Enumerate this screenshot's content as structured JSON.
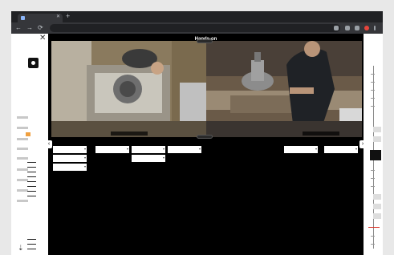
{
  "browser": {
    "tab_title": "",
    "new_tab": "+",
    "back": "←",
    "forward": "→",
    "reload": "⟳",
    "url": ""
  },
  "left_panel": {
    "pager": "",
    "close": "✕",
    "accent_color": "#f0a040",
    "footer_arrow": "⇣"
  },
  "right_panel": {
    "time": "",
    "date_day": "",
    "date_month": "",
    "marker_color": "#d93025",
    "badge": ""
  },
  "main": {
    "info_label": "",
    "title": "Hands-on",
    "zoom_out": "",
    "zoom_in": "",
    "prev": "‹",
    "next": "›",
    "left_video_caption": "",
    "right_video_caption": ""
  },
  "categories": [
    {
      "title": "",
      "values": [
        "",
        "",
        ""
      ]
    },
    {
      "title": "",
      "values": [
        ""
      ]
    },
    {
      "title": "",
      "values": [
        "",
        ""
      ]
    },
    {
      "title": "",
      "values": [
        ""
      ]
    },
    {
      "title": "",
      "values": []
    },
    {
      "title": "",
      "values": []
    },
    {
      "title": "",
      "values": [
        ""
      ]
    },
    {
      "title": "",
      "values": [
        ""
      ]
    }
  ]
}
